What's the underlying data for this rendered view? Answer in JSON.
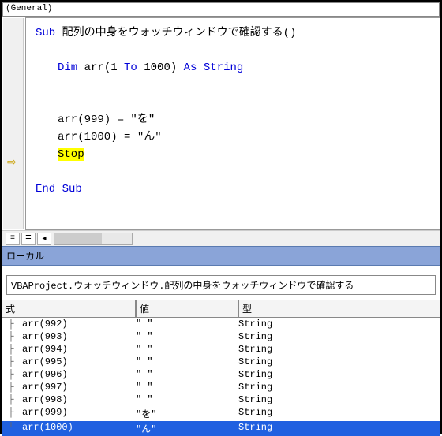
{
  "dropdown_label": "(General)",
  "code": {
    "sub_kw": "Sub",
    "sub_name": " 配列の中身をウォッチウィンドウで確認する()",
    "dim_kw": "Dim",
    "dim_rest": " arr(1 ",
    "to_kw": "To",
    "dim_rest2": " 1000) ",
    "as_string": "As String",
    "line999": "arr(999) = \"を\"",
    "line1000": "arr(1000) = \"ん\"",
    "stop_kw": "Stop",
    "end_sub": "End Sub"
  },
  "locals": {
    "title": "ローカル",
    "context": "VBAProject.ウォッチウィンドウ.配列の中身をウォッチウィンドウで確認する",
    "col_expr": "式",
    "col_value": "値",
    "col_type": "型"
  },
  "rows": [
    {
      "expr": "arr(992)",
      "value": "\" \"",
      "type": "String",
      "last": false
    },
    {
      "expr": "arr(993)",
      "value": "\" \"",
      "type": "String",
      "last": false
    },
    {
      "expr": "arr(994)",
      "value": "\" \"",
      "type": "String",
      "last": false
    },
    {
      "expr": "arr(995)",
      "value": "\" \"",
      "type": "String",
      "last": false
    },
    {
      "expr": "arr(996)",
      "value": "\" \"",
      "type": "String",
      "last": false
    },
    {
      "expr": "arr(997)",
      "value": "\" \"",
      "type": "String",
      "last": false
    },
    {
      "expr": "arr(998)",
      "value": "\" \"",
      "type": "String",
      "last": false
    },
    {
      "expr": "arr(999)",
      "value": "\"を\"",
      "type": "String",
      "last": false
    },
    {
      "expr": "arr(1000)",
      "value": "\"ん\"",
      "type": "String",
      "last": true,
      "sel": true
    }
  ]
}
